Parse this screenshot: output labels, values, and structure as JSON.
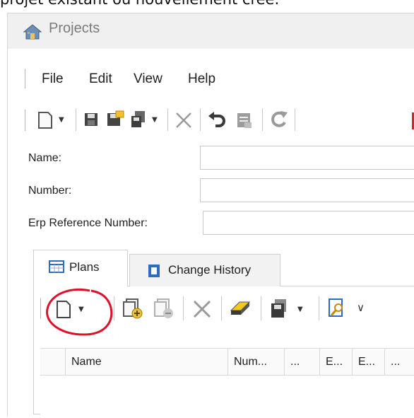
{
  "caption": "projet existant ou nouvellement créé.",
  "window": {
    "title": "Projects"
  },
  "menu": [
    "File",
    "Edit",
    "View",
    "Help"
  ],
  "form": {
    "fields": [
      {
        "label": "Name:",
        "value": ""
      },
      {
        "label": "Number:",
        "value": ""
      },
      {
        "label": "Erp Reference Number:",
        "value": ""
      }
    ]
  },
  "tabs": [
    {
      "label": "Plans",
      "active": true
    },
    {
      "label": "Change History",
      "active": false
    }
  ],
  "grid": {
    "columns": [
      "Name",
      "Num...",
      "...",
      "E...",
      "E...",
      "..."
    ]
  },
  "icons": [
    "app-house-icon",
    "new-icon",
    "save-icon",
    "save-as-icon",
    "copy-icon",
    "delete-icon",
    "undo-icon",
    "report-icon",
    "refresh-icon",
    "add-item-icon",
    "remove-item-icon",
    "eraser-icon",
    "layers-icon",
    "search-doc-icon"
  ],
  "colors": {
    "annotation": "#e0102a",
    "accent_blue": "#2b6cc4"
  }
}
